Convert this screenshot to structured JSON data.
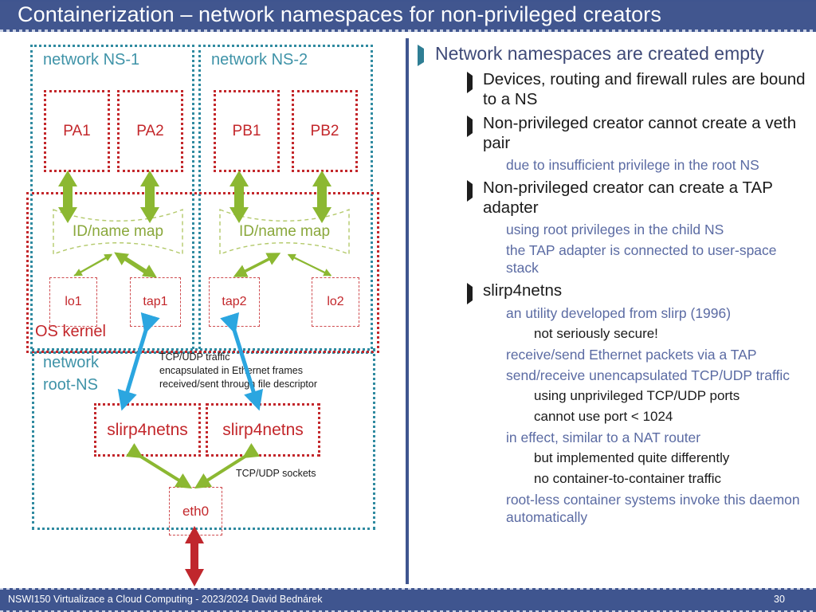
{
  "slide": {
    "title": "Containerization – network namespaces for non-privileged creators",
    "footer_text": "NSWI150 Virtualizace a Cloud Computing - 2023/2024 David Bednárek",
    "page_number": "30",
    "colors": {
      "title_bar": "#3f558f",
      "namespace_border": "#2f8aa0",
      "kernel_border": "#c3272b",
      "process_border": "#c3272b",
      "map_green": "#8aa83c",
      "arrow_green": "#8cb832",
      "arrow_blue": "#2ba6e0",
      "arrow_red": "#c0272d",
      "bullet_l1_text": "#3f4a78",
      "bullet_l3_text": "#5b6ba3"
    }
  },
  "diagram": {
    "ns1": {
      "label": "network NS-1"
    },
    "ns2": {
      "label": "network NS-2"
    },
    "kernel": {
      "label": "OS kernel"
    },
    "rootns": {
      "label_line1": "network",
      "label_line2": "root-NS"
    },
    "processes": [
      {
        "name": "PA1"
      },
      {
        "name": "PA2"
      },
      {
        "name": "PB1"
      },
      {
        "name": "PB2"
      }
    ],
    "maps": [
      {
        "label": "ID/name map"
      },
      {
        "label": "ID/name map"
      }
    ],
    "devices": [
      {
        "name": "lo1"
      },
      {
        "name": "tap1"
      },
      {
        "name": "tap2"
      },
      {
        "name": "lo2"
      }
    ],
    "daemons": [
      {
        "name": "slirp4netns"
      },
      {
        "name": "slirp4netns"
      }
    ],
    "nic": {
      "name": "eth0"
    },
    "annotations": {
      "tap_traffic": [
        "TCP/UDP traffic",
        "encapsulated in Ethernet frames",
        "received/sent through file descriptor"
      ],
      "sockets": "TCP/UDP sockets"
    }
  },
  "bullets": [
    {
      "level": 1,
      "text": "Network namespaces are created empty"
    },
    {
      "level": 2,
      "text": "Devices, routing and firewall rules are bound to a NS"
    },
    {
      "level": 2,
      "text": "Non-privileged creator cannot create a veth pair"
    },
    {
      "level": 3,
      "text": "due to insufficient privilege in the root NS"
    },
    {
      "level": 2,
      "text": "Non-privileged creator can create a TAP adapter"
    },
    {
      "level": 3,
      "text": "using root privileges in the child NS"
    },
    {
      "level": 3,
      "text": "the TAP adapter is connected to user-space stack"
    },
    {
      "level": 2,
      "text": "slirp4netns"
    },
    {
      "level": 3,
      "text": "an utility developed from slirp (1996)"
    },
    {
      "level": 4,
      "text": "not seriously secure!"
    },
    {
      "level": 3,
      "text": "receive/send Ethernet packets via a TAP"
    },
    {
      "level": 3,
      "text": "send/receive unencapsulated TCP/UDP traffic"
    },
    {
      "level": 4,
      "text": "using unprivileged TCP/UDP ports"
    },
    {
      "level": 4,
      "text": "cannot use port < 1024"
    },
    {
      "level": 3,
      "text": "in effect, similar to a NAT router"
    },
    {
      "level": 4,
      "text": "but implemented quite differently"
    },
    {
      "level": 4,
      "text": "no container-to-container traffic"
    },
    {
      "level": 3,
      "text": "root-less container systems invoke this daemon automatically"
    }
  ]
}
